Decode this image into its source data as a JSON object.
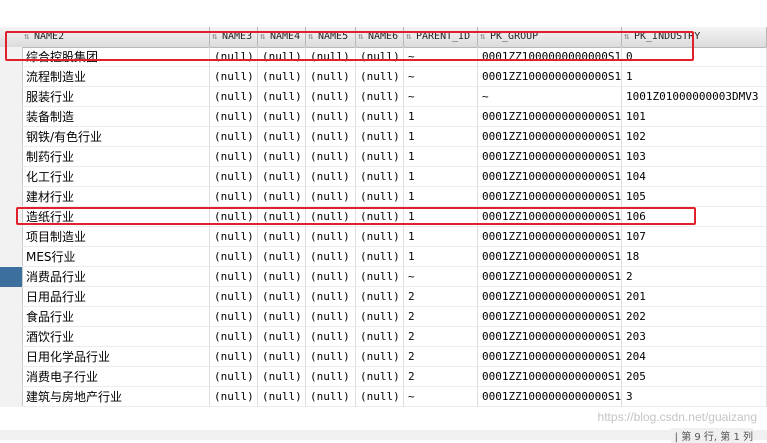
{
  "columns": [
    "NAME2",
    "NAME3",
    "NAME4",
    "NAME5",
    "NAME6",
    "PARENT_ID",
    "PK_GROUP",
    "PK_INDUSTRY"
  ],
  "rows": [
    [
      "综合控股集团",
      "(null)",
      "(null)",
      "(null)",
      "(null)",
      "~",
      "0001ZZ1000000000000S1",
      "0"
    ],
    [
      "流程制造业",
      "(null)",
      "(null)",
      "(null)",
      "(null)",
      "~",
      "0001ZZ1000000000000S1",
      "1"
    ],
    [
      "服装行业",
      "(null)",
      "(null)",
      "(null)",
      "(null)",
      "~",
      "~",
      "1001Z01000000003DMV3"
    ],
    [
      "装备制造",
      "(null)",
      "(null)",
      "(null)",
      "(null)",
      "1",
      "0001ZZ1000000000000S1",
      "101"
    ],
    [
      "钢铁/有色行业",
      "(null)",
      "(null)",
      "(null)",
      "(null)",
      "1",
      "0001ZZ1000000000000S1",
      "102"
    ],
    [
      "制药行业",
      "(null)",
      "(null)",
      "(null)",
      "(null)",
      "1",
      "0001ZZ1000000000000S1",
      "103"
    ],
    [
      "化工行业",
      "(null)",
      "(null)",
      "(null)",
      "(null)",
      "1",
      "0001ZZ1000000000000S1",
      "104"
    ],
    [
      "建材行业",
      "(null)",
      "(null)",
      "(null)",
      "(null)",
      "1",
      "0001ZZ1000000000000S1",
      "105"
    ],
    [
      "造纸行业",
      "(null)",
      "(null)",
      "(null)",
      "(null)",
      "1",
      "0001ZZ1000000000000S1",
      "106"
    ],
    [
      "项目制造业",
      "(null)",
      "(null)",
      "(null)",
      "(null)",
      "1",
      "0001ZZ1000000000000S1",
      "107"
    ],
    [
      "MES行业",
      "(null)",
      "(null)",
      "(null)",
      "(null)",
      "1",
      "0001ZZ1000000000000S1",
      "18"
    ],
    [
      "消费品行业",
      "(null)",
      "(null)",
      "(null)",
      "(null)",
      "~",
      "0001ZZ1000000000000S1",
      "2"
    ],
    [
      "日用品行业",
      "(null)",
      "(null)",
      "(null)",
      "(null)",
      "2",
      "0001ZZ1000000000000S1",
      "201"
    ],
    [
      "食品行业",
      "(null)",
      "(null)",
      "(null)",
      "(null)",
      "2",
      "0001ZZ1000000000000S1",
      "202"
    ],
    [
      "酒饮行业",
      "(null)",
      "(null)",
      "(null)",
      "(null)",
      "2",
      "0001ZZ1000000000000S1",
      "203"
    ],
    [
      "日用化学品行业",
      "(null)",
      "(null)",
      "(null)",
      "(null)",
      "2",
      "0001ZZ1000000000000S1",
      "204"
    ],
    [
      "消费电子行业",
      "(null)",
      "(null)",
      "(null)",
      "(null)",
      "2",
      "0001ZZ1000000000000S1",
      "205"
    ],
    [
      "建筑与房地产行业",
      "(null)",
      "(null)",
      "(null)",
      "(null)",
      "~",
      "0001ZZ1000000000000S1",
      "3"
    ]
  ],
  "selected_row_index": 11,
  "highlighted_row_indices": [
    0,
    8
  ],
  "highlight_color": "#e0202a",
  "selected_marker_color": "#3c6e9e",
  "sort_icon": "sort-arrows-icon",
  "status": {
    "text": "| 第 9 行, 第 1 列"
  },
  "watermark": "https://blog.csdn.net/guaizang"
}
